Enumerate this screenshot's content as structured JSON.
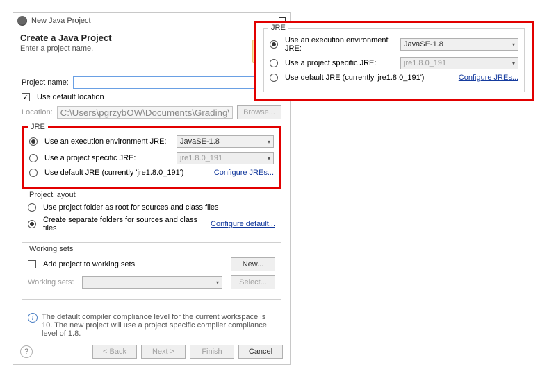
{
  "titlebar": {
    "title": "New Java Project"
  },
  "header": {
    "heading": "Create a Java Project",
    "sub": "Enter a project name."
  },
  "project_name": {
    "label": "Project name:",
    "value": ""
  },
  "default_location": {
    "checkbox_label": "Use default location",
    "location_label": "Location:",
    "location_value": "C:\\Users\\pgrzybOW\\Documents\\Grading\\workspace",
    "browse": "Browse..."
  },
  "jre": {
    "group_title": "JRE",
    "opt1": "Use an execution environment JRE:",
    "opt1_value": "JavaSE-1.8",
    "opt2": "Use a project specific JRE:",
    "opt2_value": "jre1.8.0_191",
    "opt3": "Use default JRE (currently 'jre1.8.0_191')",
    "configure": "Configure JREs..."
  },
  "layout": {
    "group_title": "Project layout",
    "opt1": "Use project folder as root for sources and class files",
    "opt2": "Create separate folders for sources and class files",
    "configure": "Configure default..."
  },
  "ws": {
    "group_title": "Working sets",
    "checkbox": "Add project to working sets",
    "new_btn": "New...",
    "label": "Working sets:",
    "select_btn": "Select..."
  },
  "info": "The default compiler compliance level for the current workspace is 10. The new project will use a project specific compiler compliance level of 1.8.",
  "footer": {
    "back": "< Back",
    "next": "Next >",
    "finish": "Finish",
    "cancel": "Cancel"
  }
}
